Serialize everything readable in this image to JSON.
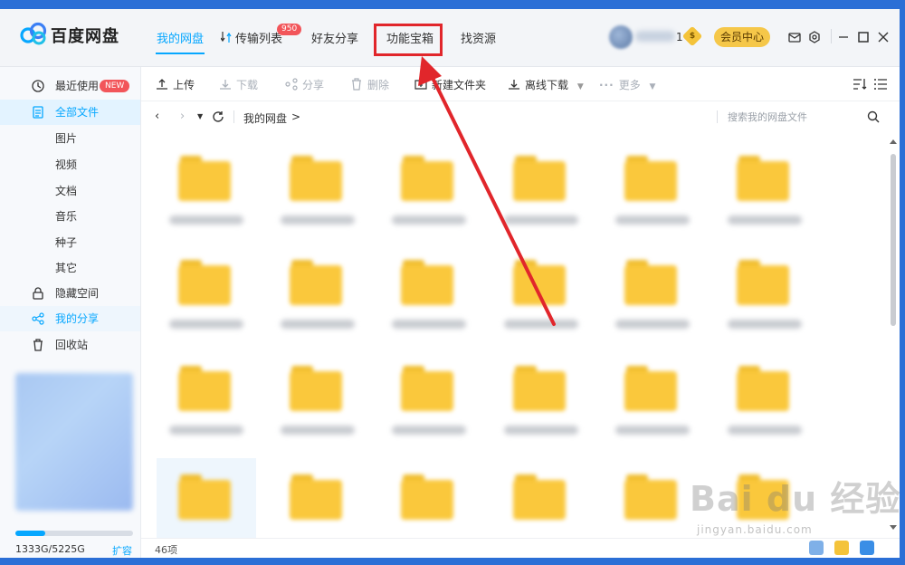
{
  "app": {
    "brand": "百度网盘"
  },
  "nav": {
    "tabs": [
      {
        "label": "我的网盘"
      },
      {
        "label": "传输列表"
      },
      {
        "label": "好友分享"
      },
      {
        "label": "功能宝箱"
      },
      {
        "label": "找资源"
      }
    ],
    "transfer_badge": "950"
  },
  "user": {
    "number": "1",
    "coin_symbol": "$",
    "vip_label": "会员中心"
  },
  "sidebar": {
    "items": [
      {
        "label": "最近使用",
        "badge": "NEW"
      },
      {
        "label": "全部文件"
      },
      {
        "label": "图片"
      },
      {
        "label": "视频"
      },
      {
        "label": "文档"
      },
      {
        "label": "音乐"
      },
      {
        "label": "种子"
      },
      {
        "label": "其它"
      },
      {
        "label": "隐藏空间"
      },
      {
        "label": "我的分享"
      },
      {
        "label": "回收站"
      }
    ],
    "storage_text": "1333G/5225G",
    "storage_used_fraction": 0.255,
    "expand_label": "扩容"
  },
  "toolbar": {
    "upload": "上传",
    "download": "下载",
    "share": "分享",
    "delete": "删除",
    "new_folder": "新建文件夹",
    "offline_download": "离线下载",
    "more": "更多"
  },
  "pathbar": {
    "crumb": "我的网盘",
    "sep": ">",
    "search_placeholder": "搜索我的网盘文件"
  },
  "status": {
    "item_count": "46项"
  },
  "watermark": {
    "main": "Bai du 经验",
    "sub": "jingyan.baidu.com"
  },
  "colors": {
    "accent": "#06a7ff",
    "folder": "#fac83c",
    "highlight": "#e1262b",
    "vip": "#f5c749"
  }
}
